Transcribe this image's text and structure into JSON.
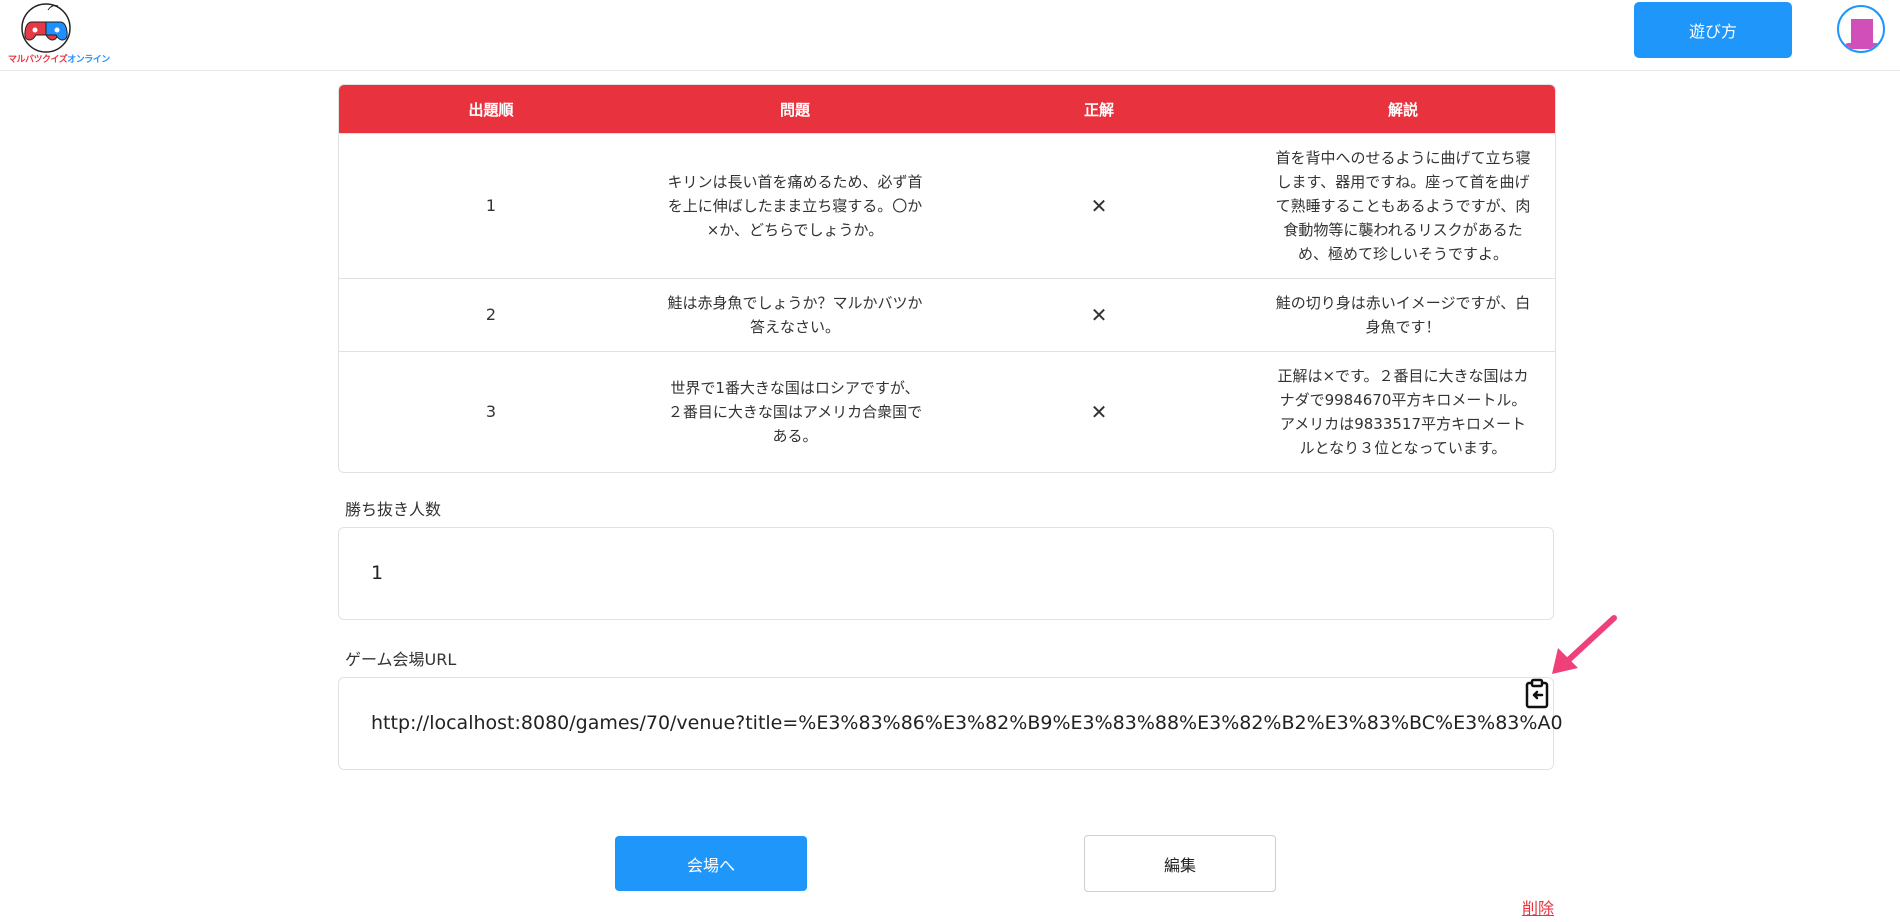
{
  "header": {
    "logo_text_red": "マルバツクイズ",
    "logo_text_blue": "オンライン",
    "howto_label": "遊び方",
    "avatar_icon": "user-avatar-icon"
  },
  "table": {
    "headers": [
      "出題順",
      "問題",
      "正解",
      "解説"
    ],
    "rows": [
      {
        "order": "1",
        "question": "キリンは長い首を痛めるため、必ず首を上に伸ばしたまま立ち寝する。〇か×か、どちらでしょうか。",
        "answer": "✕",
        "explanation": "首を背中へのせるように曲げて立ち寝します、器用ですね。座って首を曲げて熟睡することもあるようですが、肉食動物等に襲われるリスクがあるため、極めて珍しいそうですよ。"
      },
      {
        "order": "2",
        "question": "鮭は赤身魚でしょうか？マルかバツか答えなさい。",
        "answer": "✕",
        "explanation": "鮭の切り身は赤いイメージですが、白身魚です！"
      },
      {
        "order": "3",
        "question": "世界で1番大きな国はロシアですが、２番目に大きな国はアメリカ合衆国である。",
        "answer": "✕",
        "explanation": "正解は×です。２番目に大きな国はカナダで9984670平方キロメートル。アメリカは9833517平方キロメートルとなり３位となっています。"
      }
    ]
  },
  "winners": {
    "label": "勝ち抜き人数",
    "value": "1"
  },
  "venue_url": {
    "label": "ゲーム会場URL",
    "value": "http://localhost:8080/games/70/venue?title=%E3%83%86%E3%82%B9%E3%83%88%E3%82%B2%E3%83%BC%E3%83%A0",
    "copy_icon": "clipboard-copy-icon",
    "arrow_color": "#f0407a"
  },
  "actions": {
    "venue_label": "会場へ",
    "edit_label": "編集",
    "delete_label": "削除"
  },
  "colors": {
    "accent_blue": "#1e96fa",
    "table_header_red": "#e8333f"
  }
}
